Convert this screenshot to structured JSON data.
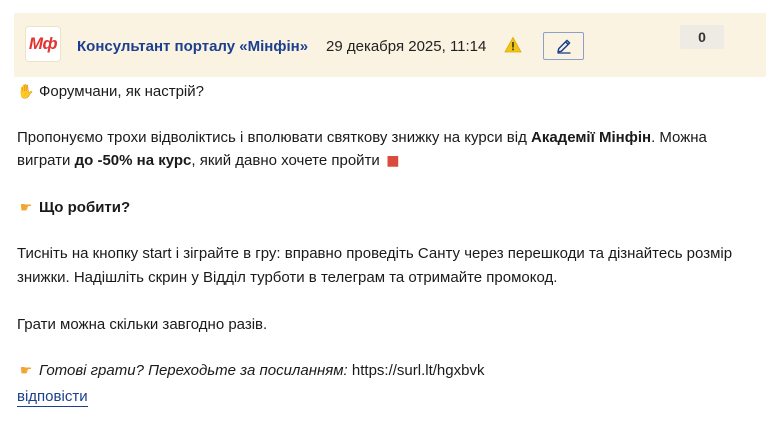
{
  "header": {
    "avatar_text": "Мф",
    "author": "Консультант порталу «Мінфін»",
    "datetime": "29 декабря 2025, 11:14",
    "counter": "0",
    "warning_icon": "warning-icon",
    "edit_icon": "pencil-icon"
  },
  "post": {
    "greeting": "Форумчани, як настрій?",
    "para1_l1_pre": "Пропонуємо трохи відволіктись і вполювати святкову знижку на курси від ",
    "para1_l1_bold": "Академії Мінфін",
    "para1_l1_post": ". Можна",
    "para1_l2_pre": "виграти ",
    "para1_l2_bold": "до -50% на курс",
    "para1_l2_post": ", який давно хочете пройти",
    "what_to_do": "Що робити?",
    "para2_l1": "Тисніть на кнопку start і зіграйте в гру: вправно проведіть Санту через перешкоди та дізнайтесь розмір",
    "para2_l2": "знижки. Надішліть скрин у Відділ турботи в телеграм та отримайте промокод.",
    "para3": "Грати можна скільки завгодно разів.",
    "cta_italic": "Готові грати? Переходьте за посиланням:",
    "cta_link": "https://surl.lt/hgxbvk"
  },
  "actions": {
    "reply": "відповісти"
  },
  "colors": {
    "header_bg": "#fbf3e1",
    "brand_red": "#e3342f",
    "link_blue": "#1c3f8f"
  }
}
